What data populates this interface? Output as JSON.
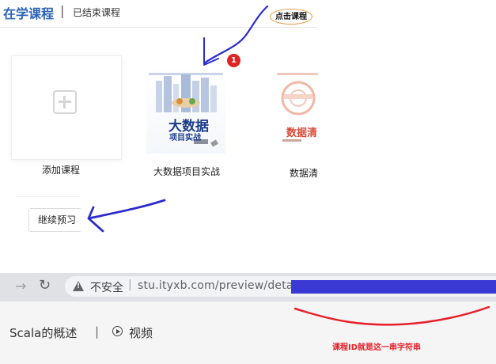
{
  "tabs": {
    "active": "在学课程",
    "separator": "|",
    "ended": "已结束课程"
  },
  "annotations": {
    "click_course": "点击课程",
    "step_number": "1",
    "course_id_note": "课程ID就是这一串字符串"
  },
  "courses": [
    {
      "label": "添加课程",
      "type": "add"
    },
    {
      "label": "大数据项目实战",
      "cover_title": "大数据",
      "cover_subtitle": "项目实战"
    },
    {
      "label": "数据清洗",
      "cover_title": "数据清"
    }
  ],
  "continue_button": "继续预习",
  "browser": {
    "security": "不安全",
    "separator": "|",
    "url": "stu.ityxb.com/preview/detail/"
  },
  "lesson": {
    "title": "Scala的概述",
    "separator": "|",
    "video_label": "视频"
  },
  "colors": {
    "tab_active": "#2b63b8",
    "annotation_blue": "#2a2ad0",
    "annotation_red": "#e8202a",
    "badge_border": "#e6953f"
  }
}
